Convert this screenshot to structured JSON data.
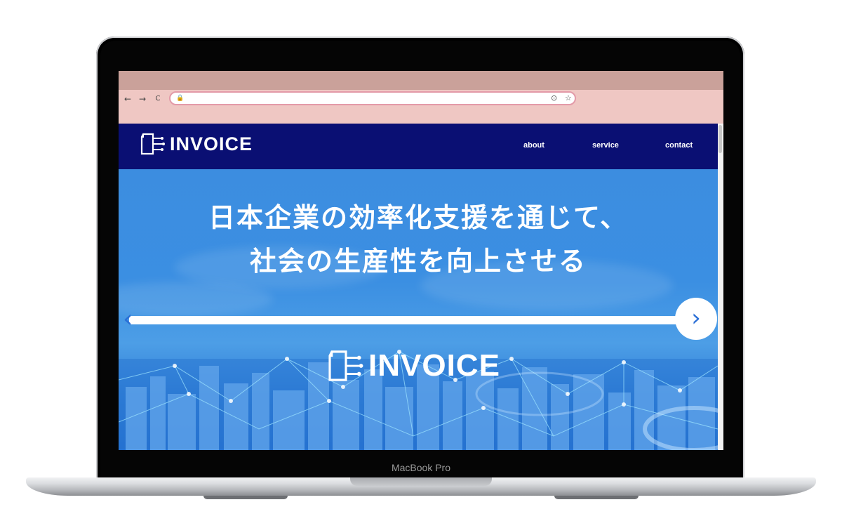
{
  "device": {
    "label": "MacBook Pro"
  },
  "browser": {
    "back_icon": "←",
    "forward_icon": "→",
    "reload_icon": "C",
    "lock_icon": "🔒",
    "address_value": "",
    "share_icon": "⊙",
    "bookmark_icon": "☆"
  },
  "site": {
    "logo_text": "INVOICE",
    "nav": {
      "about": "about",
      "service": "service",
      "contact": "contact"
    },
    "hero": {
      "line1": "日本企業の効率化支援を通じて、",
      "line2": "社会の生産性を向上させる",
      "prev_icon": "‹",
      "next_icon": "›",
      "brand_text": "INVOICE"
    }
  },
  "colors": {
    "header": "#0a0f73",
    "hero_blue": "#3b8fe2",
    "chrome": "#efc7c3"
  }
}
